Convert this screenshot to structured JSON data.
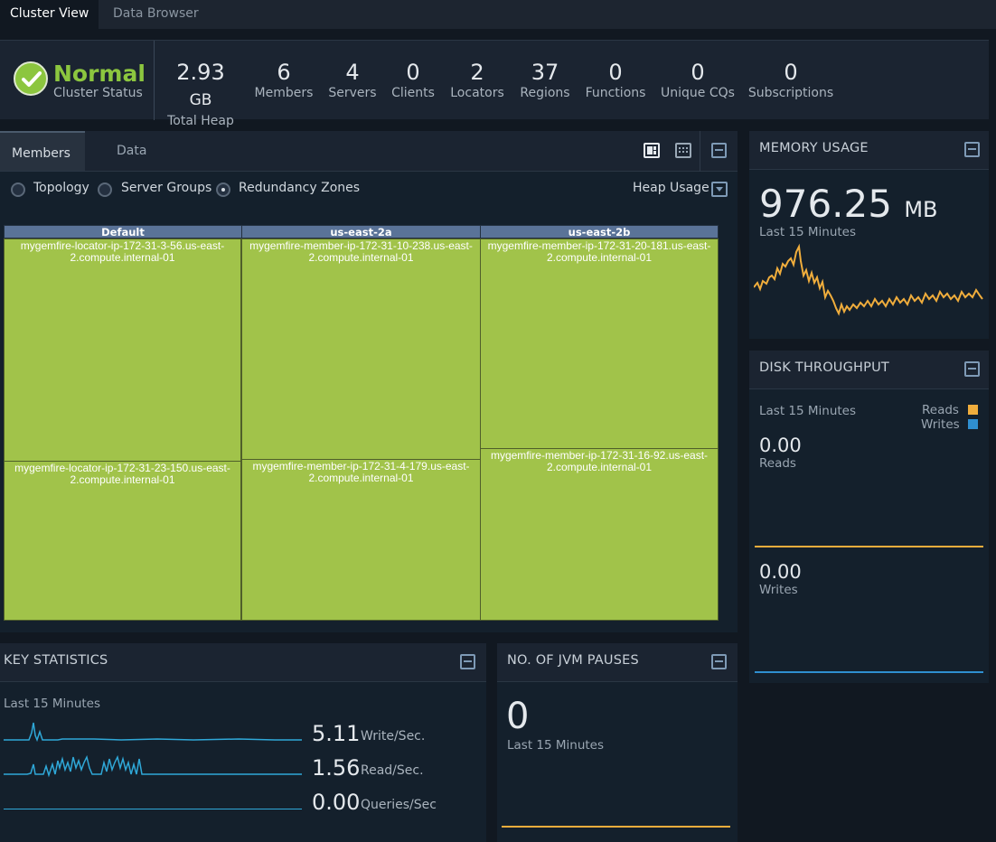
{
  "tabs": [
    {
      "label": "Cluster View"
    },
    {
      "label": "Data Browser"
    }
  ],
  "status": {
    "value": "Normal",
    "label": "Cluster Status",
    "color": "#8cc63f"
  },
  "stats": [
    {
      "value": "2.93",
      "unit": "GB",
      "label": "Total Heap"
    },
    {
      "value": "6",
      "label": "Members"
    },
    {
      "value": "4",
      "label": "Servers"
    },
    {
      "value": "0",
      "label": "Clients"
    },
    {
      "value": "2",
      "label": "Locators"
    },
    {
      "value": "37",
      "label": "Regions"
    },
    {
      "value": "0",
      "label": "Functions"
    },
    {
      "value": "0",
      "label": "Unique CQs"
    },
    {
      "value": "0",
      "label": "Subscriptions"
    }
  ],
  "members_panel": {
    "tabs": [
      {
        "label": "Members"
      },
      {
        "label": "Data"
      }
    ],
    "views": [
      {
        "label": "Topology"
      },
      {
        "label": "Server Groups"
      },
      {
        "label": "Redundancy Zones",
        "selected": true
      }
    ],
    "metric": "Heap Usage",
    "zones": [
      {
        "name": "Default",
        "members": [
          "mygemfire-locator-ip-172-31-3-56.us-east-2.compute.internal-01",
          "mygemfire-locator-ip-172-31-23-150.us-east-2.compute.internal-01"
        ]
      },
      {
        "name": "us-east-2a",
        "members": [
          "mygemfire-member-ip-172-31-10-238.us-east-2.compute.internal-01",
          "mygemfire-member-ip-172-31-4-179.us-east-2.compute.internal-01"
        ]
      },
      {
        "name": "us-east-2b",
        "members": [
          "mygemfire-member-ip-172-31-20-181.us-east-2.compute.internal-01",
          "mygemfire-member-ip-172-31-16-92.us-east-2.compute.internal-01"
        ]
      }
    ],
    "tile_color": "#a1c34a"
  },
  "memory": {
    "title": "MEMORY USAGE",
    "value": "976.25",
    "unit": "MB",
    "period": "Last 15 Minutes",
    "line_color": "#f0ad3c"
  },
  "disk": {
    "title": "DISK THROUGHPUT",
    "period": "Last 15 Minutes",
    "legend_reads": "Reads",
    "legend_writes": "Writes",
    "reads_value": "0.00",
    "reads_label": "Reads",
    "writes_value": "0.00",
    "writes_label": "Writes",
    "reads_color": "#f0ad3c",
    "writes_color": "#2f8fd0"
  },
  "key_stats": {
    "title": "KEY STATISTICS",
    "period": "Last 15 Minutes",
    "rows": [
      {
        "value": "5.11",
        "unit": "Write/Sec."
      },
      {
        "value": "1.56",
        "unit": "Read/Sec."
      },
      {
        "value": "0.00",
        "unit": "Queries/Sec"
      }
    ],
    "line_color": "#2fa8d8"
  },
  "jvm": {
    "title": "NO. OF JVM PAUSES",
    "value": "0",
    "period": "Last 15 Minutes"
  }
}
